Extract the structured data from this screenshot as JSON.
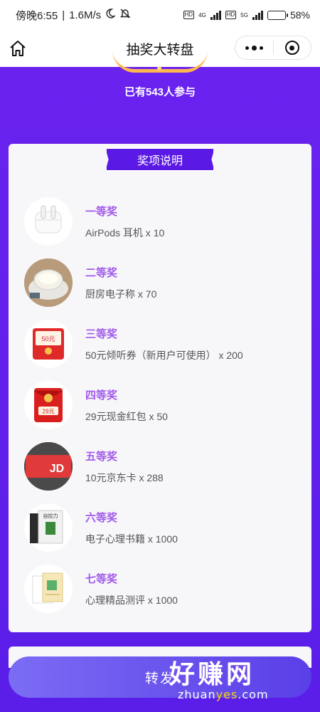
{
  "status_bar": {
    "time_text": "傍晚6:55",
    "speed_text": "1.6M/s",
    "network_4g": "4G",
    "network_5g": "5G",
    "hd_label": "HD",
    "battery_percent": "58%",
    "battery_level": 0.58
  },
  "nav": {
    "title": "抽奖大转盘"
  },
  "participants": "已有543人参与",
  "prize_section": {
    "title": "奖项说明",
    "items": [
      {
        "level": "一等奖",
        "desc": "AirPods 耳机 x 10",
        "icon": "airpods-icon"
      },
      {
        "level": "二等奖",
        "desc": "厨房电子称 x 70",
        "icon": "kitchen-scale-icon"
      },
      {
        "level": "三等奖",
        "desc": "50元倾听券（新用户可使用） x 200",
        "icon": "coupon-icon",
        "badge": "50元"
      },
      {
        "level": "四等奖",
        "desc": "29元现金红包 x 50",
        "icon": "red-envelope-icon",
        "badge": "29元"
      },
      {
        "level": "五等奖",
        "desc": "10元京东卡 x 288",
        "icon": "jd-card-icon",
        "badge": "JD"
      },
      {
        "level": "六等奖",
        "desc": "电子心理书籍 x 1000",
        "icon": "ebook-icon",
        "badge": "自控力"
      },
      {
        "level": "七等奖",
        "desc": "心理精品测评 x 1000",
        "icon": "assessment-icon"
      }
    ]
  },
  "share_button": {
    "label": "转发"
  },
  "watermark": {
    "main": "好赚网",
    "sub_prefix": "zhuan",
    "sub_highlight": "yes",
    "sub_suffix": ".com"
  },
  "colors": {
    "background": "#6a22ef",
    "accent_purple": "#5b19e6",
    "prize_level": "#a259e9",
    "wheel_rim": "#ffb84d"
  }
}
